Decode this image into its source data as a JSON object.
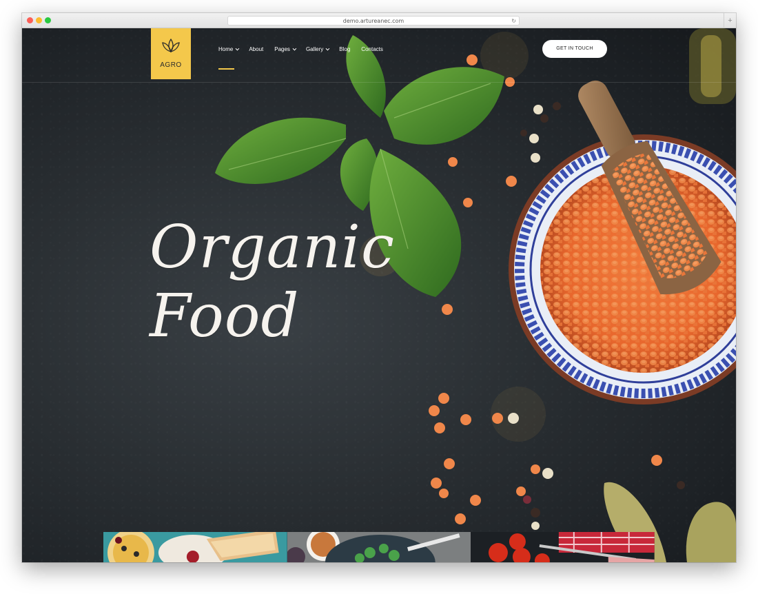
{
  "browser": {
    "url": "demo.artureanec.com",
    "reload_icon": "reload-icon",
    "new_tab": "+"
  },
  "logo": {
    "text": "AGRO",
    "icon": "leaf-icon",
    "color": "#f4c84b"
  },
  "nav": {
    "items": [
      {
        "label": "Home",
        "dropdown": true,
        "active": true
      },
      {
        "label": "About",
        "dropdown": false
      },
      {
        "label": "Pages",
        "dropdown": true
      },
      {
        "label": "Gallery",
        "dropdown": true
      },
      {
        "label": "Blog",
        "dropdown": false
      },
      {
        "label": "Contacts",
        "dropdown": false
      }
    ],
    "cta": "GET IN TOUCH"
  },
  "hero": {
    "title_line1": "Organic",
    "title_line2": "Food"
  },
  "thumbnails": [
    {
      "name": "breakfast-thumbnail"
    },
    {
      "name": "salad-thumbnail"
    },
    {
      "name": "tomatoes-thumbnail"
    }
  ],
  "colors": {
    "accent": "#f4c84b",
    "background": "#23282c",
    "text": "#ffffff"
  }
}
